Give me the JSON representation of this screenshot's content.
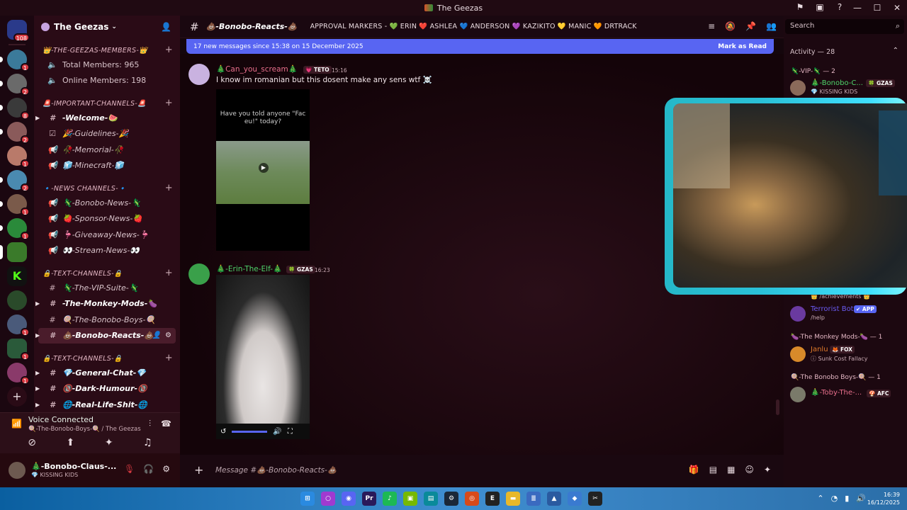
{
  "window": {
    "title": "The Geezas"
  },
  "server": {
    "name": "The Geezas"
  },
  "guild_badges": [
    "108",
    "1",
    "2",
    "8",
    "2",
    "1",
    "2",
    "1",
    "1",
    "1",
    "1",
    "1"
  ],
  "categories": [
    {
      "name": "👑-THE-GEEZAS-MEMBERS-👑",
      "channels": [
        {
          "label": "Total Members: 965",
          "icon": "speaker"
        },
        {
          "label": "Online Members: 198",
          "icon": "speaker"
        }
      ]
    },
    {
      "name": "🚨-IMPORTANT-CHANNELS-🚨",
      "channels": [
        {
          "label": "-Welcome-🍉",
          "icon": "hash"
        },
        {
          "label": "🎉-Guidelines-🎉",
          "icon": "rules"
        },
        {
          "label": "🥀-Memorial-🥀",
          "icon": "announce"
        },
        {
          "label": "🧊-Minecraft-🧊",
          "icon": "announce"
        }
      ]
    },
    {
      "name": "🔹-NEWS CHANNELS-🔹",
      "channels": [
        {
          "label": "🦎-Bonobo-News-🦎",
          "icon": "announce"
        },
        {
          "label": "🍓-Sponsor-News-🍓",
          "icon": "announce"
        },
        {
          "label": "🦩-Giveaway-News-🦩",
          "icon": "announce"
        },
        {
          "label": "👀-Stream-News-👀",
          "icon": "announce"
        }
      ]
    },
    {
      "name": "🔒-TEXT-CHANNELS-🔒",
      "channels": [
        {
          "label": "🦎-The-VIP-Suite-🦎",
          "icon": "hash"
        },
        {
          "label": "-The-Monkey-Mods-🍆",
          "icon": "hash"
        },
        {
          "label": "🍭-The-Bonobo-Boys-🍭",
          "icon": "hash"
        },
        {
          "label": "💩-Bonobo-Reacts-💩",
          "icon": "hash"
        }
      ]
    },
    {
      "name": "🔒-TEXT-CHANNELS-🔒",
      "channels": [
        {
          "label": "💎-General-Chat-💎",
          "icon": "hash"
        },
        {
          "label": "🔞-Dark-Humour-🔞",
          "icon": "hash"
        },
        {
          "label": "🌐-Real-Life-Shit-🌐",
          "icon": "hash"
        }
      ]
    }
  ],
  "voice": {
    "status": "Voice Connected",
    "channel": "🍭-The-Bonobo-Boys-🍭 / The Geezas"
  },
  "user": {
    "name": "🎄-Bonobo-Claus-...",
    "status": "💎 KISSING KIDS"
  },
  "header": {
    "channel": "💩-Bonobo-Reacts-💩",
    "topic": "APPROVAL MARKERS - 💚 ERIN ❤️ ASHLEA 💙 ANDERSON 💜 KAZIKITO 💛 MANIC 🧡 DRTRACK"
  },
  "new_messages": {
    "text": "17 new messages since 15:38 on 15 December 2025",
    "action": "Mark as Read"
  },
  "messages": [
    {
      "author": "🎄Can_you_scream🎄",
      "tag": "💗 TETO",
      "time": "15:16",
      "text": "I know im romanian but this dosent make any sens wtf ☠️",
      "embed_caption": "Have you told anyone \"Fac eu!\" today?"
    },
    {
      "author": "🎄-Erin-The-Elf-🎄",
      "tag": "🍀 GZAS",
      "time": "16:23"
    }
  ],
  "composer": {
    "placeholder": "Message #💩-Bonobo-Reacts-💩"
  },
  "search": {
    "placeholder": "Search"
  },
  "activity": {
    "label": "Activity — 28"
  },
  "member_groups": [
    {
      "label": "🦎-VIP-🦎 — 2"
    },
    {
      "label": "🍆-The Monkey Mods-🍆 — 1"
    },
    {
      "label": "🍭-The Bonobo Boys-🍭 — 1"
    }
  ],
  "members": [
    {
      "name": "🎄-Bonobo-C...",
      "tag": "🍀 GZAS",
      "sub": "💎 KISSING KIDS"
    },
    {
      "name": "",
      "sub": "👑 /achievements 👑"
    },
    {
      "name": "Terrorist Bot",
      "tag": "✔ APP",
      "sub": "/help"
    },
    {
      "name": "Janlu",
      "tag": "🦊 FOX",
      "sub": "ⓘ Sunk Cost Fallacy"
    },
    {
      "name": "🎄-Toby-The-...",
      "tag": "🍄 AFC",
      "sub": ""
    }
  ],
  "clock": {
    "time": "16:39",
    "date": "16/12/2025"
  },
  "colors": {
    "accent": "#5865f2",
    "sidebar": "#2a0b16",
    "online": "#2dc770",
    "cam_border": "#40e0ff"
  }
}
